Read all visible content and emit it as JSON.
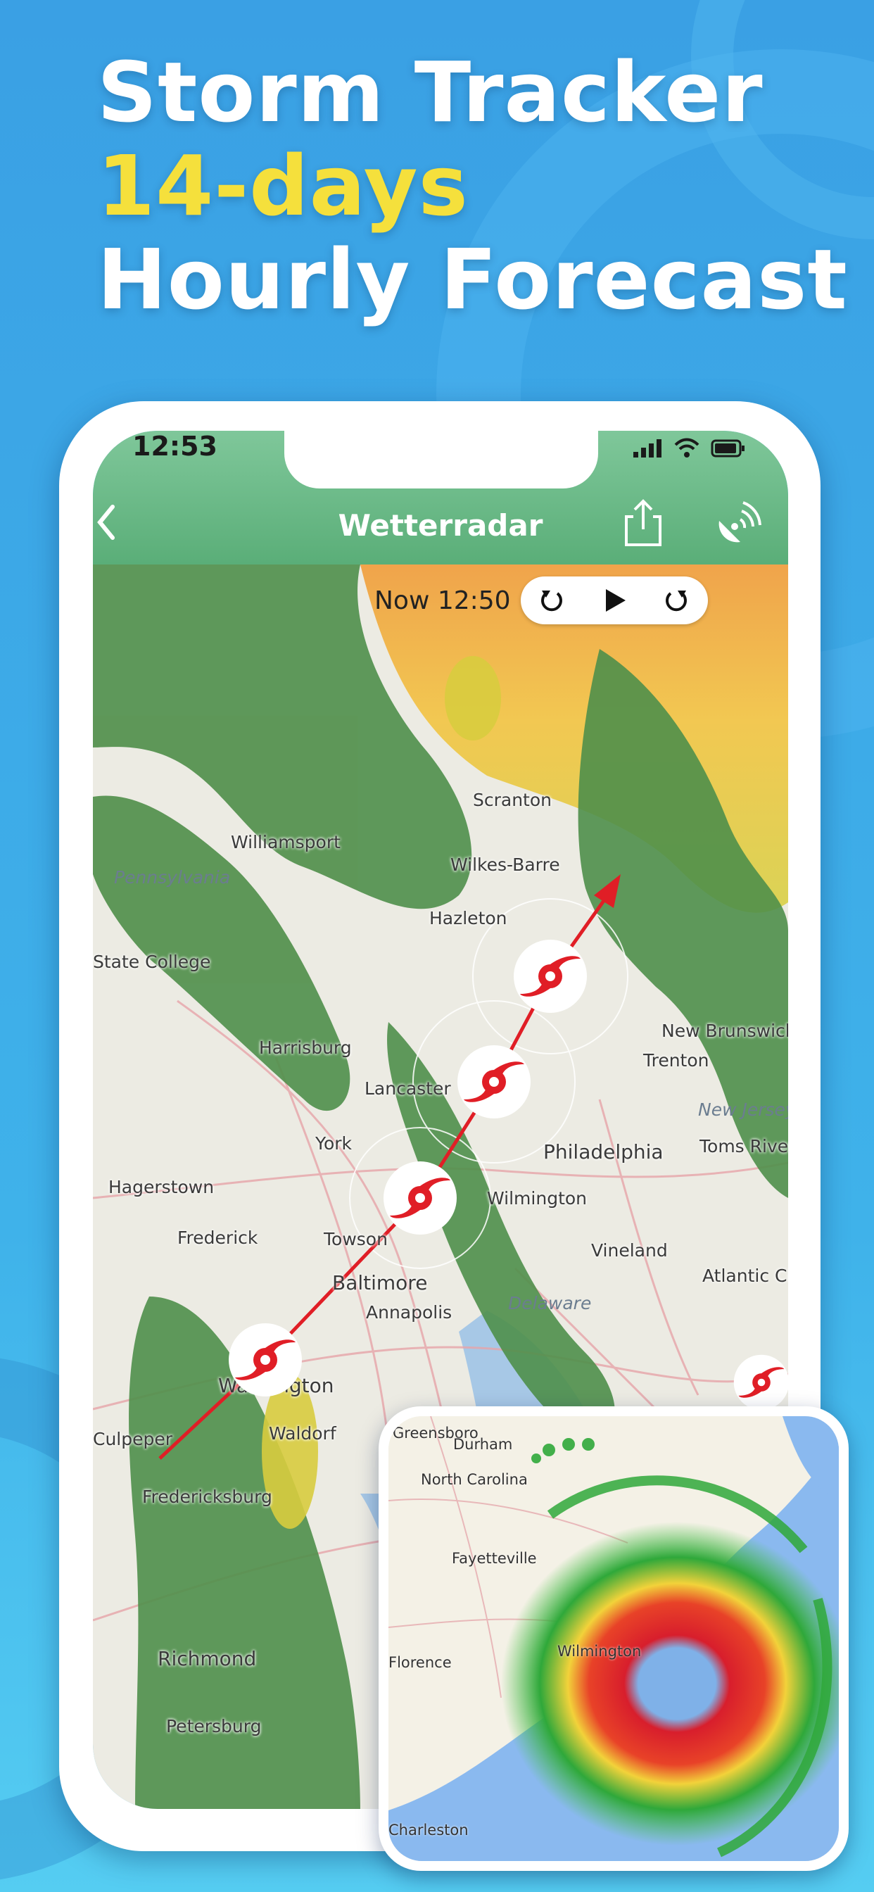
{
  "headline": {
    "line1": "Storm Tracker",
    "line2": "14-days",
    "line3": "Hourly Forecast"
  },
  "colors": {
    "background": "#3aa0e4",
    "highlight": "#f5e03c",
    "text_white": "#ffffff",
    "appbar": "#6bbb88",
    "track_red": "#e01e26"
  },
  "status_bar": {
    "time": "12:53"
  },
  "app_bar": {
    "title": "Wetterradar",
    "back_icon": "chevron-left-icon",
    "share_icon": "share-icon",
    "satellite_icon": "satellite-dish-icon"
  },
  "playback": {
    "time_label": "Now 12:50",
    "buttons": [
      "rewind-icon",
      "play-icon",
      "forward-icon"
    ]
  },
  "map_places": [
    "Scranton",
    "Williamsport",
    "Wilkes-Barre",
    "Hazleton",
    "State College",
    "Harrisburg",
    "Lancaster",
    "York",
    "Trenton",
    "New Brunswick",
    "Philadelphia",
    "Toms River",
    "Hagerstown",
    "Frederick",
    "Towson",
    "Wilmington",
    "Vineland",
    "Baltimore",
    "Annapolis",
    "Atlantic City",
    "Washington",
    "Waldorf",
    "Culpeper",
    "Fredericksburg",
    "Richmond",
    "Petersburg"
  ],
  "map_states": [
    "Pennsylvania",
    "New Jersey",
    "Delaware"
  ],
  "inset_places": [
    "Greensboro",
    "Durham",
    "North Carolina",
    "Fayetteville",
    "Wilmington",
    "Florence",
    "Charleston"
  ]
}
